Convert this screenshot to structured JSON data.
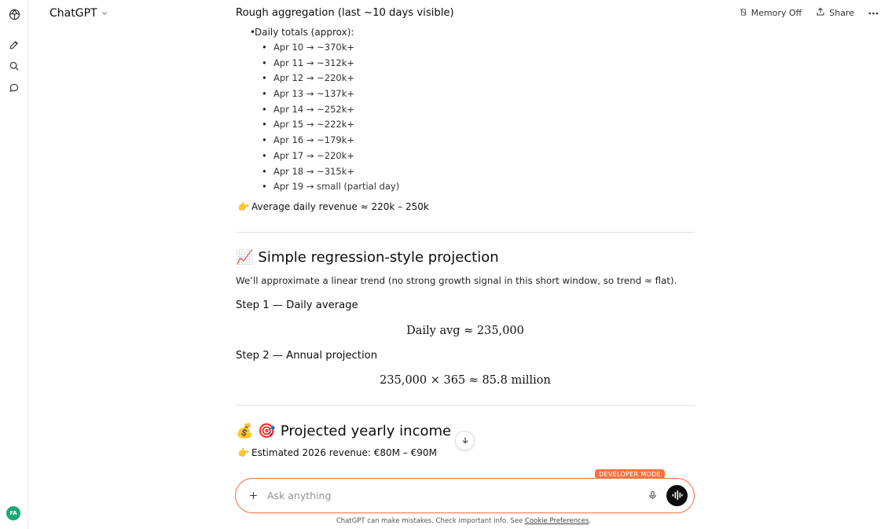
{
  "header": {
    "model_name": "ChatGPT",
    "memory_label": "Memory Off",
    "share_label": "Share"
  },
  "user": {
    "avatar_initials": "FA"
  },
  "message": {
    "aggregation_heading": "Rough aggregation (last ~10 days visible)",
    "daily_totals_label": "Daily totals (approx):",
    "daily_totals": [
      "Apr 10 → ~370k+",
      "Apr 11 → ~312k+",
      "Apr 12 → ~220k+",
      "Apr 13 → ~137k+",
      "Apr 14 → ~252k+",
      "Apr 15 → ~222k+",
      "Apr 16 → ~179k+",
      "Apr 17 → ~220k+",
      "Apr 18 → ~315k+",
      "Apr 19 → small (partial day)"
    ],
    "average_line_emoji": "👉",
    "average_line": "Average daily revenue ≈ 220k – 250k",
    "regression_emoji": "📈",
    "regression_heading": "Simple regression-style projection",
    "regression_intro": "We’ll approximate a linear trend (no strong growth signal in this short window, so trend ≈ flat).",
    "step1_heading": "Step 1 — Daily average",
    "step1_math": "Daily avg ≈ 235,000",
    "step2_heading": "Step 2 — Annual projection",
    "step2_math": "235,000 × 365 ≈ 85.8 million",
    "income_emoji_1": "💰",
    "income_emoji_2": "🎯",
    "income_heading": "Projected yearly income",
    "estimate_emoji": "👉",
    "estimate_line": "Estimated 2026 revenue: €80M – €90M"
  },
  "composer": {
    "badge": "DEVELOPER MODE",
    "placeholder": "Ask anything"
  },
  "footer": {
    "text": "ChatGPT can make mistakes. Check important info. See ",
    "link": "Cookie Preferences",
    "end": "."
  }
}
